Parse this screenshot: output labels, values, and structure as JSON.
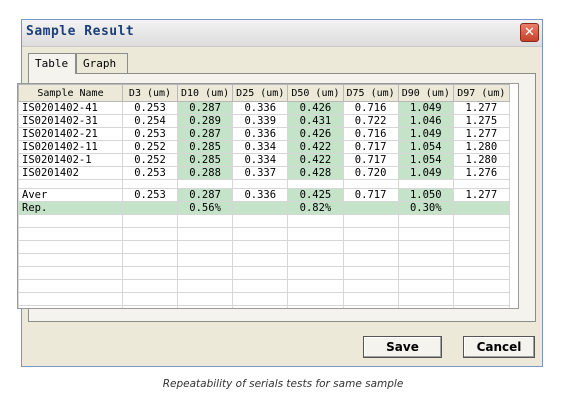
{
  "window": {
    "title": "Sample Result"
  },
  "tabs": [
    {
      "label": "Table",
      "active": true
    },
    {
      "label": "Graph",
      "active": false
    }
  ],
  "table": {
    "columns": [
      "Sample Name",
      "D3 (um)",
      "D10 (um)",
      "D25 (um)",
      "D50 (um)",
      "D75 (um)",
      "D90 (um)",
      "D97 (um)"
    ],
    "rows": [
      {
        "name": "IS0201402-41",
        "values": [
          "0.253",
          "0.287",
          "0.336",
          "0.426",
          "0.716",
          "1.049",
          "1.277"
        ]
      },
      {
        "name": "IS0201402-31",
        "values": [
          "0.254",
          "0.289",
          "0.339",
          "0.431",
          "0.722",
          "1.046",
          "1.275"
        ]
      },
      {
        "name": "IS0201402-21",
        "values": [
          "0.253",
          "0.287",
          "0.336",
          "0.426",
          "0.716",
          "1.049",
          "1.277"
        ]
      },
      {
        "name": "IS0201402-11",
        "values": [
          "0.252",
          "0.285",
          "0.334",
          "0.422",
          "0.717",
          "1.054",
          "1.280"
        ]
      },
      {
        "name": "IS0201402-1",
        "values": [
          "0.252",
          "0.285",
          "0.334",
          "0.422",
          "0.717",
          "1.054",
          "1.280"
        ]
      },
      {
        "name": "IS0201402",
        "values": [
          "0.253",
          "0.288",
          "0.337",
          "0.428",
          "0.720",
          "1.049",
          "1.276"
        ]
      }
    ],
    "summary": [
      {
        "name": "Aver",
        "values": [
          "0.253",
          "0.287",
          "0.336",
          "0.425",
          "0.717",
          "1.050",
          "1.277"
        ]
      },
      {
        "name": "Rep.",
        "values": [
          "",
          "0.56%",
          "",
          "0.82%",
          "",
          "0.30%",
          ""
        ]
      }
    ],
    "green_columns": [
      1,
      3,
      5
    ]
  },
  "buttons": {
    "save": "Save",
    "cancel": "Cancel"
  },
  "caption": "Repeatability of serials tests for same sample",
  "colors": {
    "highlight": "#c5e3c8",
    "title_text": "#1c3f78",
    "close_button": "#c8402a"
  }
}
